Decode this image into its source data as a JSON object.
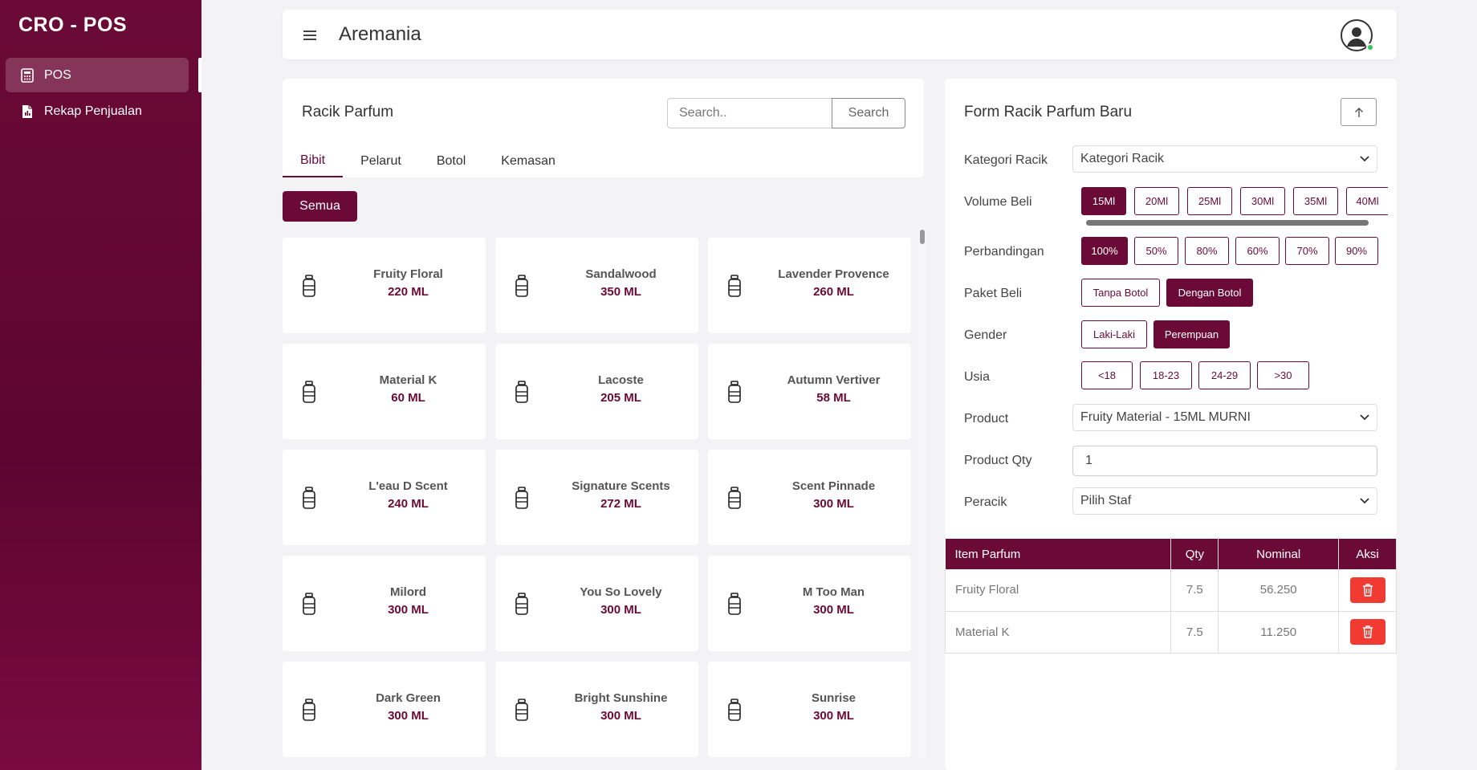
{
  "sidebar": {
    "brand": "CRO - POS",
    "items": [
      {
        "label": "POS",
        "icon": "calculator-icon"
      },
      {
        "label": "Rekap Penjualan",
        "icon": "report-icon"
      }
    ]
  },
  "header": {
    "title": "Aremania"
  },
  "racik": {
    "title": "Racik Parfum",
    "search_placeholder": "Search..",
    "search_button": "Search",
    "tabs": [
      "Bibit",
      "Pelarut",
      "Botol",
      "Kemasan"
    ],
    "filter_button": "Semua",
    "products": [
      {
        "name": "Fruity Floral",
        "volume": "220 ML"
      },
      {
        "name": "Sandalwood",
        "volume": "350 ML"
      },
      {
        "name": "Lavender Provence",
        "volume": "260 ML"
      },
      {
        "name": "Material K",
        "volume": "60 ML"
      },
      {
        "name": "Lacoste",
        "volume": "205 ML"
      },
      {
        "name": "Autumn Vertiver",
        "volume": "58 ML"
      },
      {
        "name": "L'eau D Scent",
        "volume": "240 ML"
      },
      {
        "name": "Signature Scents",
        "volume": "272 ML"
      },
      {
        "name": "Scent Pinnade",
        "volume": "300 ML"
      },
      {
        "name": "Milord",
        "volume": "300 ML"
      },
      {
        "name": "You So Lovely",
        "volume": "300 ML"
      },
      {
        "name": "M Too Man",
        "volume": "300 ML"
      },
      {
        "name": "Dark Green",
        "volume": "300 ML"
      },
      {
        "name": "Bright Sunshine",
        "volume": "300 ML"
      },
      {
        "name": "Sunrise",
        "volume": "300 ML"
      }
    ]
  },
  "form": {
    "title": "Form Racik Parfum Baru",
    "kategori": {
      "label": "Kategori Racik",
      "value": "Kategori Racik"
    },
    "volume": {
      "label": "Volume Beli",
      "options": [
        "15Ml",
        "20Ml",
        "25Ml",
        "30Ml",
        "35Ml",
        "40Ml"
      ],
      "selected": "15Ml"
    },
    "perbandingan": {
      "label": "Perbandingan",
      "options": [
        "100%",
        "50%",
        "80%",
        "60%",
        "70%",
        "90%"
      ],
      "selected": "100%"
    },
    "paket": {
      "label": "Paket Beli",
      "options": [
        "Tanpa Botol",
        "Dengan Botol"
      ],
      "selected": "Dengan Botol"
    },
    "gender": {
      "label": "Gender",
      "options": [
        "Laki-Laki",
        "Perempuan"
      ],
      "selected": "Perempuan"
    },
    "usia": {
      "label": "Usia",
      "options": [
        "<18",
        "18-23",
        "24-29",
        ">30"
      ]
    },
    "product": {
      "label": "Product",
      "value": "Fruity Material - 15ML MURNI"
    },
    "qty": {
      "label": "Product Qty",
      "value": "1"
    },
    "peracik": {
      "label": "Peracik",
      "value": "Pilih Staf"
    }
  },
  "table": {
    "headers": [
      "Item Parfum",
      "Qty",
      "Nominal",
      "Aksi"
    ],
    "rows": [
      {
        "item": "Fruity Floral",
        "qty": "7.5",
        "nominal": "56.250"
      },
      {
        "item": "Material K",
        "qty": "7.5",
        "nominal": "11.250"
      }
    ]
  },
  "colors": {
    "primary": "#6b0a36",
    "danger": "#f03a32",
    "online": "#39c25a"
  }
}
